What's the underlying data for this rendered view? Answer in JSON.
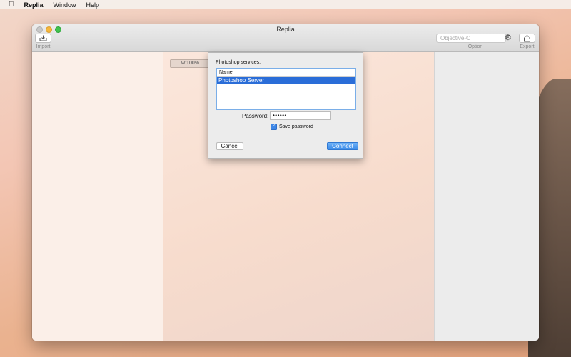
{
  "menubar": {
    "apple": "",
    "app_name": "Replia",
    "items": [
      "Window",
      "Help"
    ]
  },
  "window": {
    "title": "Replia"
  },
  "toolbar": {
    "import_label": "Import",
    "language_placeholder": "Objective-C",
    "option_label": "Option",
    "export_label": "Export"
  },
  "canvas": {
    "zoom": "w:100%"
  },
  "dialog": {
    "services_label": "Photoshop services:",
    "list_header": "Name",
    "list_items": [
      "Photoshop Server"
    ],
    "password_label": "Password:",
    "password_value": "••••••",
    "save_password_label": "Save password",
    "save_password_checked": true,
    "cancel_label": "Cancel",
    "connect_label": "Connect"
  },
  "colors": {
    "accent": "#2a6dd8",
    "connect_button": "#3b8ce9"
  },
  "icons": {
    "import": "import-tray-icon",
    "export": "share-export-icon",
    "option": "gear-icon"
  }
}
